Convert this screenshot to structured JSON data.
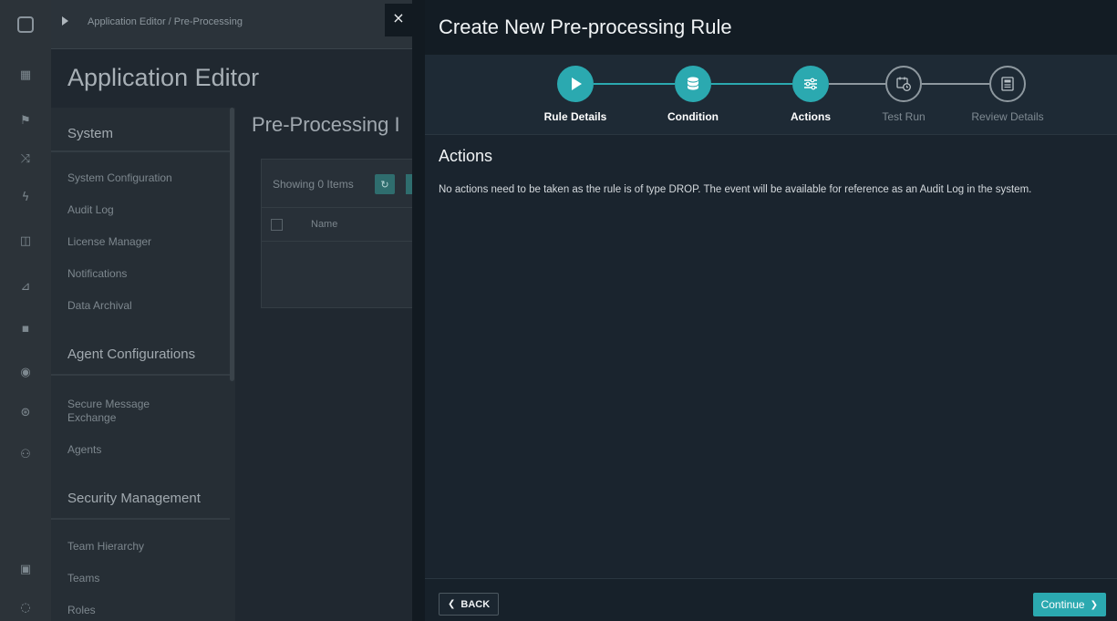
{
  "background": {
    "breadcrumb": "Application Editor / Pre-Processing",
    "app_title": "Application Editor",
    "main_title": "Pre-Processing I",
    "menu_sections": [
      {
        "heading": "System",
        "items": [
          "System Configuration",
          "Audit Log",
          "License Manager",
          "Notifications",
          "Data Archival"
        ]
      },
      {
        "heading": "Agent Configurations",
        "items": [
          "Secure Message Exchange",
          "Agents"
        ]
      },
      {
        "heading": "Security Management",
        "items": [
          "Team Hierarchy",
          "Teams",
          "Roles"
        ]
      }
    ],
    "list": {
      "showing": "Showing 0 Items",
      "refresh_icon": "refresh-icon",
      "column": "Name"
    }
  },
  "drawer": {
    "close_icon": "×",
    "title": "Create New Pre-processing Rule",
    "steps": [
      {
        "label": "Rule Details",
        "state": "done",
        "icon": "play-icon"
      },
      {
        "label": "Condition",
        "state": "done",
        "icon": "database-icon"
      },
      {
        "label": "Actions",
        "state": "done",
        "icon": "sliders-icon"
      },
      {
        "label": "Test Run",
        "state": "todo",
        "icon": "calendar-clock-icon"
      },
      {
        "label": "Review Details",
        "state": "todo",
        "icon": "document-icon"
      }
    ],
    "section_title": "Actions",
    "section_text": "No actions need to be taken as the rule is of type DROP. The event will be available for reference as an Audit Log in the system.",
    "back_label": "BACK",
    "continue_label": "Continue"
  },
  "colors": {
    "accent": "#2ba9b0",
    "drawer_bg": "#1a242e",
    "header_bg": "#131c24"
  }
}
